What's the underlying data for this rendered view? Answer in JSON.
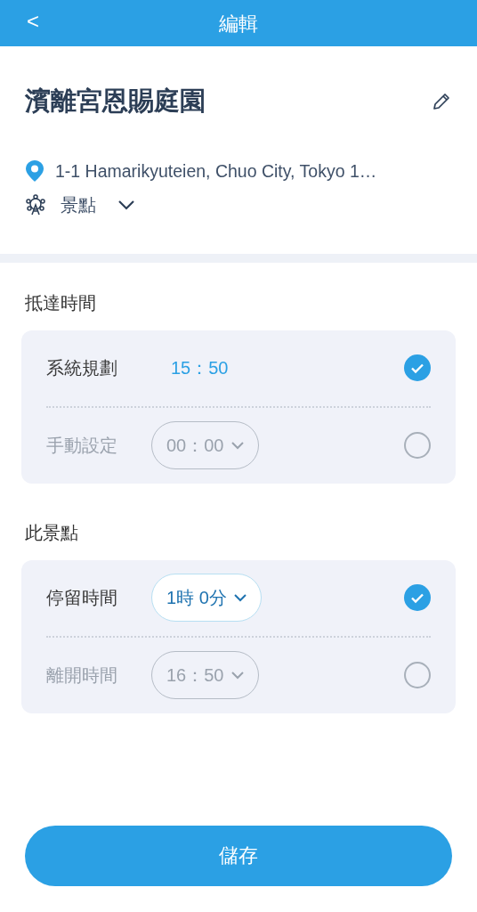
{
  "header": {
    "back": "<",
    "title": "編輯"
  },
  "place": {
    "name": "濱離宮恩賜庭園",
    "address": "1-1 Hamarikyuteien, Chuo City, Tokyo 1…",
    "category": "景點"
  },
  "sections": [
    {
      "title": "抵達時間",
      "options": [
        {
          "label": "系統規劃",
          "kind": "plain",
          "value": "15：50",
          "selected": true
        },
        {
          "label": "手動設定",
          "kind": "dropdown",
          "value": "00：00",
          "selected": false
        }
      ]
    },
    {
      "title": "此景點",
      "options": [
        {
          "label": "停留時間",
          "kind": "dropdown",
          "value": "1時 0分",
          "selected": true
        },
        {
          "label": "離開時間",
          "kind": "dropdown",
          "value": "16：50",
          "selected": false
        }
      ]
    }
  ],
  "save_button": "儲存"
}
